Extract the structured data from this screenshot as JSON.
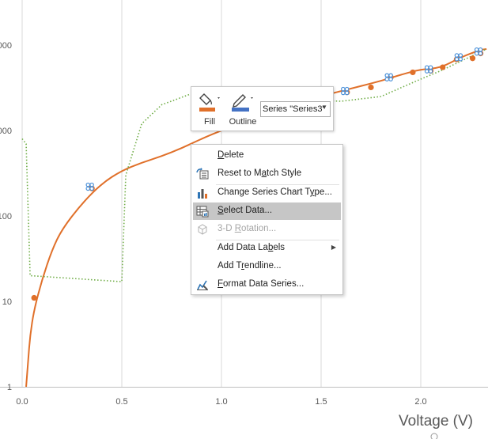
{
  "chart_data": {
    "type": "scatter",
    "title": "",
    "xlabel": "Voltage (V)",
    "ylabel": "",
    "x_ticks": [
      "0.0",
      "0.5",
      "1.0",
      "1.5",
      "2.0"
    ],
    "y_ticks": [
      "1",
      "10",
      "100",
      "000",
      "000"
    ],
    "xlim": [
      0,
      2.33
    ],
    "ylim_log": [
      1,
      20000
    ],
    "y_scale": "log",
    "grid": "vertical",
    "colors": {
      "orange": "#e0702a",
      "green_dotted": "#70ad47",
      "blue_marker": "#4a90d9",
      "gridline": "#d9d9d9"
    },
    "series": [
      {
        "style": "orange-solid-line",
        "points": [
          [
            0.02,
            1
          ],
          [
            0.03,
            2
          ],
          [
            0.04,
            4
          ],
          [
            0.06,
            8
          ],
          [
            0.1,
            18
          ],
          [
            0.15,
            40
          ],
          [
            0.2,
            70
          ],
          [
            0.3,
            140
          ],
          [
            0.4,
            240
          ],
          [
            0.5,
            340
          ],
          [
            0.6,
            420
          ],
          [
            0.7,
            500
          ],
          [
            0.8,
            620
          ],
          [
            0.9,
            800
          ],
          [
            1.0,
            1000
          ],
          [
            1.2,
            1500
          ],
          [
            1.4,
            2200
          ],
          [
            1.6,
            2900
          ],
          [
            1.8,
            3800
          ],
          [
            1.9,
            4500
          ],
          [
            2.0,
            5200
          ],
          [
            2.1,
            5400
          ],
          [
            2.2,
            7200
          ],
          [
            2.3,
            8800
          ],
          [
            2.33,
            9000
          ]
        ]
      },
      {
        "style": "green-dotted-line",
        "points": [
          [
            0.0,
            800
          ],
          [
            0.02,
            700
          ],
          [
            0.04,
            20
          ],
          [
            0.5,
            17
          ],
          [
            0.52,
            300
          ],
          [
            0.6,
            1200
          ],
          [
            0.7,
            2000
          ],
          [
            0.85,
            2700
          ],
          [
            1.0,
            2800
          ],
          [
            1.2,
            2500
          ],
          [
            1.4,
            2300
          ],
          [
            1.6,
            2200
          ],
          [
            1.8,
            2500
          ],
          [
            2.0,
            4000
          ],
          [
            2.1,
            5000
          ],
          [
            2.33,
            9000
          ]
        ]
      },
      {
        "style": "orange-markers",
        "points": [
          [
            0.06,
            11
          ],
          [
            0.35,
            210
          ],
          [
            1.63,
            2800
          ],
          [
            1.75,
            3200
          ],
          [
            1.85,
            4200
          ],
          [
            1.96,
            4800
          ],
          [
            2.05,
            5000
          ],
          [
            2.11,
            5500
          ],
          [
            2.18,
            6800
          ],
          [
            2.26,
            7000
          ],
          [
            2.3,
            8000
          ]
        ]
      },
      {
        "style": "blue-cross-markers",
        "points": [
          [
            0.34,
            220
          ],
          [
            1.62,
            2900
          ],
          [
            1.84,
            4200
          ],
          [
            2.04,
            5200
          ],
          [
            2.19,
            7200
          ],
          [
            2.29,
            8400
          ]
        ]
      }
    ]
  },
  "minitoolbar": {
    "fill_label": "Fill",
    "outline_label": "Outline",
    "series_select_value": "Series \"Series3\"",
    "fill_icon": "paint-bucket-icon",
    "outline_icon": "pencil-outline-icon"
  },
  "context_menu": {
    "delete": {
      "pre": "",
      "key": "D",
      "post": "elete"
    },
    "reset": {
      "pre": "Reset to M",
      "key": "a",
      "post": "tch Style"
    },
    "change_type": {
      "pre": "Change Series Chart T",
      "key": "y",
      "post": "pe..."
    },
    "select_data": {
      "pre": "",
      "key": "S",
      "post": "elect Data..."
    },
    "rotation": {
      "pre": "3-D ",
      "key": "R",
      "post": "otation..."
    },
    "add_labels": {
      "pre": "Add Data La",
      "key": "b",
      "post": "els"
    },
    "add_trendline": {
      "pre": "Add T",
      "key": "r",
      "post": "endline..."
    },
    "format_series": {
      "pre": "",
      "key": "F",
      "post": "ormat Data Series..."
    }
  }
}
